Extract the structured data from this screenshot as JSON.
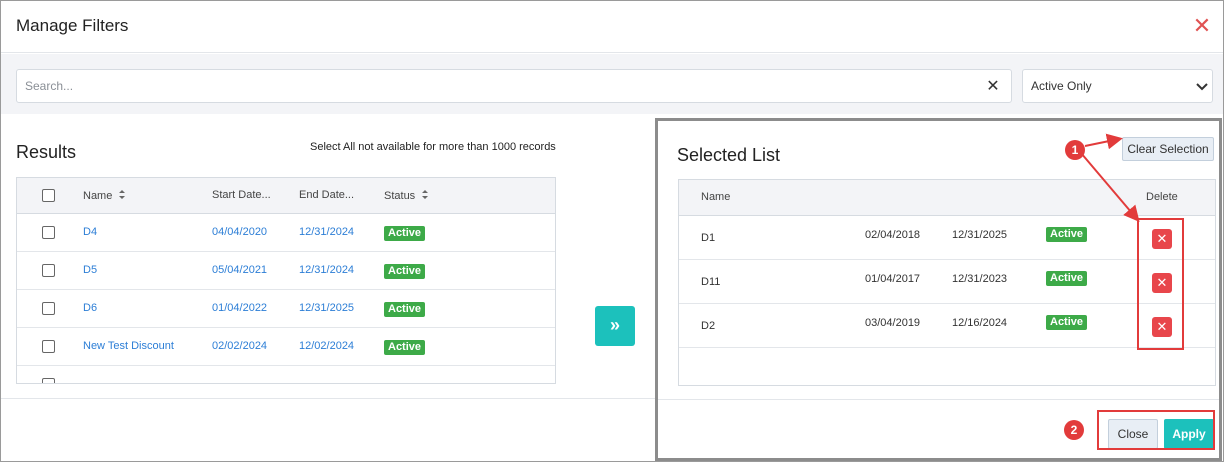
{
  "dialog": {
    "title": "Manage Filters",
    "close_icon": "close-icon"
  },
  "search": {
    "placeholder": "Search...",
    "value": "",
    "clear_icon": "clear-icon"
  },
  "status_filter": {
    "selected": "Active Only",
    "icon": "chevron-down-icon"
  },
  "results": {
    "title": "Results",
    "note": "Select All not available for more than 1000 records",
    "columns": [
      "Name",
      "Start Date...",
      "End Date...",
      "Status"
    ],
    "rows": [
      {
        "name": "D4",
        "start": "04/04/2020",
        "end": "12/31/2024",
        "status": "Active"
      },
      {
        "name": "D5",
        "start": "05/04/2021",
        "end": "12/31/2024",
        "status": "Active"
      },
      {
        "name": "D6",
        "start": "01/04/2022",
        "end": "12/31/2025",
        "status": "Active"
      },
      {
        "name": "New Test Discount",
        "start": "02/02/2024",
        "end": "12/02/2024",
        "status": "Active"
      }
    ]
  },
  "move_button": {
    "label": "»",
    "icon": "double-chevron-right-icon"
  },
  "selected": {
    "title": "Selected List",
    "clear_label": "Clear Selection",
    "columns": {
      "name": "Name",
      "delete": "Delete"
    },
    "rows": [
      {
        "name": "D1",
        "start": "02/04/2018",
        "end": "12/31/2025",
        "status": "Active"
      },
      {
        "name": "D11",
        "start": "01/04/2017",
        "end": "12/31/2023",
        "status": "Active"
      },
      {
        "name": "D2",
        "start": "03/04/2019",
        "end": "12/16/2024",
        "status": "Active"
      }
    ]
  },
  "footer": {
    "close_label": "Close",
    "apply_label": "Apply"
  },
  "annotations": {
    "marker_1": "1",
    "marker_2": "2"
  },
  "colors": {
    "accent_teal": "#1cc1bc",
    "status_green": "#3daa48",
    "delete_red": "#e8464b",
    "link_blue": "#2c7ed6",
    "annotation_red": "#e23b3b"
  }
}
